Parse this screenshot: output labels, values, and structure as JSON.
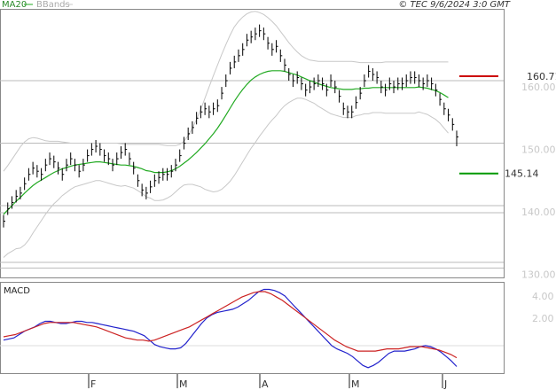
{
  "header": {
    "legend_ma": "MA20",
    "legend_bb": "BBands",
    "source": "© TEC 9/6/2024 3:0 GMT"
  },
  "colors": {
    "ma": "#22aa22",
    "bbands": "#c8c8c8",
    "candles": "#000000",
    "resistance": "#cc0000",
    "support": "#009900",
    "macd": "#2222cc",
    "signal": "#cc2222",
    "grid": "#bbbbbb"
  },
  "chart_data": [
    {
      "type": "candlestick",
      "title": "",
      "ylim": [
        120,
        170
      ],
      "y_ticks": [
        160,
        150,
        140,
        130
      ],
      "x_tick_labels": [
        "F",
        "M",
        "A",
        "M",
        "J"
      ],
      "grid": true,
      "legend": "top-left",
      "levels": [
        {
          "label": "160.71",
          "value": 160.71,
          "kind": "resistance"
        },
        {
          "label": "145.14",
          "value": 145.14,
          "kind": "support"
        }
      ],
      "series": [
        {
          "name": "price",
          "close": [
            137.5,
            139.5,
            140.5,
            141.5,
            142,
            143.5,
            145,
            146,
            145.5,
            145,
            146.5,
            147.5,
            147,
            146,
            145,
            146.5,
            147.5,
            146.5,
            145.5,
            146.5,
            148,
            149,
            149.5,
            149,
            148,
            147.5,
            146.5,
            147.5,
            148.5,
            149,
            147.5,
            146,
            144,
            142.5,
            142,
            143,
            144,
            144.5,
            145,
            145,
            145.5,
            146.5,
            148,
            150,
            151.5,
            152.5,
            154,
            155,
            155.5,
            155,
            155.5,
            156,
            158,
            160,
            162,
            163,
            164,
            165,
            166.5,
            167,
            167.5,
            168,
            167.5,
            166,
            165,
            165.5,
            164,
            162.5,
            161,
            160,
            160.5,
            159.5,
            158.5,
            159,
            159.5,
            160,
            159.5,
            158.5,
            160,
            159,
            157.5,
            155.5,
            155,
            155,
            156.5,
            158,
            160,
            161.5,
            161,
            160.5,
            159,
            158.5,
            159.5,
            159,
            159.5,
            159.5,
            160,
            160.5,
            160.5,
            160,
            159.5,
            160,
            159.5,
            158.5,
            157,
            155.5,
            154.5,
            153,
            151
          ],
          "high": [
            138.5,
            140.5,
            141.5,
            142.5,
            143,
            144.5,
            146,
            147,
            146.5,
            146,
            147.5,
            148.5,
            148,
            147,
            146,
            147.5,
            148.5,
            147.5,
            146.5,
            147.5,
            149,
            150,
            150.5,
            150,
            149,
            148.5,
            147.5,
            148.5,
            149.5,
            150,
            148.5,
            147,
            145,
            143.5,
            143,
            144,
            145,
            145.5,
            146,
            146,
            146.5,
            147.5,
            149,
            151,
            152.5,
            153.5,
            155,
            156,
            156.5,
            156,
            156.5,
            157,
            159,
            161,
            163,
            164,
            165,
            166,
            167.5,
            168,
            168.5,
            169,
            168.5,
            167,
            166,
            166.5,
            165,
            163.5,
            162,
            161,
            161.5,
            160.5,
            159.5,
            160,
            160.5,
            161,
            160.5,
            159.5,
            161,
            160,
            158.5,
            156.5,
            156,
            156,
            157.5,
            159,
            161,
            162.5,
            162,
            161.5,
            160,
            159.5,
            160.5,
            160,
            160.5,
            160.5,
            161,
            161.5,
            161.5,
            161,
            160.5,
            161,
            160.5,
            159.5,
            158,
            156.5,
            155.5,
            154,
            152
          ],
          "low": [
            136.5,
            138.5,
            139.5,
            140.5,
            141,
            142.5,
            144,
            145,
            144.5,
            144,
            145.5,
            146.5,
            146,
            145,
            144,
            145.5,
            146.5,
            145.5,
            144.5,
            145.5,
            147,
            148,
            148.5,
            148,
            147,
            146.5,
            145.5,
            146.5,
            147.5,
            148,
            146.5,
            145,
            143,
            141.5,
            141,
            142,
            143,
            143.5,
            144,
            144,
            144.5,
            145.5,
            147,
            149,
            150.5,
            151.5,
            153,
            154,
            154.5,
            154,
            154.5,
            155,
            157,
            159,
            161,
            162,
            163,
            164,
            165.5,
            166,
            166.5,
            167,
            166.5,
            165,
            164,
            164.5,
            163,
            161.5,
            160,
            159,
            159.5,
            158.5,
            157.5,
            158,
            158.5,
            159,
            158.5,
            157.5,
            159,
            158,
            156.5,
            154.5,
            154,
            154,
            155.5,
            157,
            159,
            160.5,
            160,
            159.5,
            158,
            157.5,
            158.5,
            158,
            158.5,
            158.5,
            159,
            159.5,
            159.5,
            159,
            158.5,
            159,
            158.5,
            157.5,
            156,
            154.5,
            153.5,
            152,
            149.5
          ]
        },
        {
          "name": "MA20",
          "values": [
            138.6,
            139.3,
            140,
            140.7,
            141.3,
            142,
            142.6,
            143.2,
            143.7,
            144.1,
            144.5,
            144.9,
            145.3,
            145.6,
            145.9,
            146.1,
            146.3,
            146.5,
            146.6,
            146.7,
            146.8,
            146.9,
            147,
            147,
            146.9,
            146.8,
            146.7,
            146.6,
            146.5,
            146.5,
            146.4,
            146.3,
            146.1,
            145.9,
            145.6,
            145.5,
            145.3,
            145.3,
            145.3,
            145.4,
            145.6,
            145.9,
            146.3,
            146.8,
            147.3,
            147.9,
            148.5,
            149.2,
            149.9,
            150.7,
            151.5,
            152.4,
            153.4,
            154.5,
            155.6,
            156.7,
            157.7,
            158.6,
            159.4,
            160.1,
            160.6,
            161,
            161.3,
            161.5,
            161.6,
            161.6,
            161.6,
            161.5,
            161.3,
            161.1,
            160.9,
            160.6,
            160.3,
            160,
            159.8,
            159.5,
            159.3,
            159.1,
            158.9,
            158.8,
            158.7,
            158.6,
            158.6,
            158.6,
            158.7,
            158.7,
            158.8,
            158.8,
            158.9,
            158.9,
            158.9,
            158.9,
            158.9,
            158.9,
            158.9,
            158.9,
            158.9,
            158.9,
            158.9,
            159,
            158.9,
            158.8,
            158.6,
            158.4,
            158.1,
            157.7,
            157.3
          ]
        },
        {
          "name": "BBands",
          "upper": [
            145.5,
            146.4,
            147.4,
            148.4,
            149.4,
            150.2,
            150.7,
            150.9,
            150.8,
            150.6,
            150.4,
            150.3,
            150.3,
            150.3,
            150.2,
            150.1,
            150,
            150,
            150,
            150,
            150,
            150,
            150,
            150,
            150,
            150,
            150,
            150,
            149.9,
            149.8,
            149.8,
            149.8,
            149.8,
            149.8,
            149.8,
            149.8,
            149.8,
            149.8,
            149.7,
            149.6,
            149.6,
            149.6,
            149.8,
            150.3,
            151.2,
            152.4,
            153.8,
            155.4,
            157.2,
            159,
            160.8,
            162.5,
            164.2,
            165.8,
            167.3,
            168.6,
            169.5,
            170.2,
            170.7,
            171,
            171.1,
            170.9,
            170.6,
            170.1,
            169.5,
            168.8,
            167.9,
            167,
            166.1,
            165.3,
            164.6,
            164,
            163.6,
            163.3,
            163.2,
            163.1,
            163.1,
            163.1,
            163.1,
            163.1,
            163.1,
            163.1,
            163.1,
            163.1,
            163,
            162.9,
            162.9,
            162.9,
            162.9,
            162.9,
            162.9,
            163,
            163,
            163,
            163,
            163,
            163,
            163,
            163,
            163,
            163,
            163,
            163,
            163,
            163,
            163,
            163
          ],
          "lower": [
            131.7,
            132.3,
            132.7,
            133.1,
            133.2,
            133.7,
            134.5,
            135.6,
            136.6,
            137.6,
            138.6,
            139.5,
            140.3,
            140.9,
            141.6,
            142.1,
            142.6,
            143,
            143.2,
            143.4,
            143.6,
            143.8,
            144,
            144,
            143.8,
            143.6,
            143.4,
            143.2,
            143.1,
            143.2,
            143,
            142.8,
            142.4,
            142,
            141.4,
            141.2,
            140.8,
            140.8,
            140.9,
            141.2,
            141.6,
            142.2,
            142.8,
            143.3,
            143.4,
            143.4,
            143.2,
            143,
            142.6,
            142.4,
            142.2,
            142.3,
            142.6,
            143.2,
            143.9,
            144.8,
            145.9,
            147,
            148.1,
            149.2,
            150.1,
            151.1,
            152,
            152.9,
            153.7,
            154.4,
            155.3,
            156,
            156.5,
            156.9,
            157.2,
            157.2,
            157,
            156.7,
            156.4,
            155.9,
            155.5,
            155.1,
            154.7,
            154.5,
            154.3,
            154.1,
            154.1,
            154.1,
            154.4,
            154.5,
            154.7,
            154.7,
            154.9,
            154.9,
            154.9,
            154.8,
            154.8,
            154.8,
            154.8,
            154.8,
            154.8,
            154.8,
            154.8,
            155,
            154.8,
            154.6,
            154.2,
            153.8,
            153.2,
            152.4,
            151.6
          ]
        }
      ]
    },
    {
      "type": "line",
      "title": "MACD",
      "y_ticks": [
        4,
        2
      ],
      "y_tick_labels": [
        "4.00",
        "2.00"
      ],
      "series": [
        {
          "name": "MACD",
          "values": [
            0,
            0.1,
            0.2,
            0.5,
            0.8,
            1,
            1.2,
            1.5,
            1.7,
            1.7,
            1.6,
            1.5,
            1.5,
            1.6,
            1.7,
            1.7,
            1.6,
            1.6,
            1.5,
            1.4,
            1.3,
            1.2,
            1.1,
            1,
            0.9,
            0.8,
            0.6,
            0.4,
            0,
            -0.4,
            -0.6,
            -0.7,
            -0.8,
            -0.8,
            -0.7,
            -0.3,
            0.3,
            0.9,
            1.5,
            2,
            2.3,
            2.5,
            2.6,
            2.7,
            2.8,
            3,
            3.3,
            3.6,
            4,
            4.4,
            4.6,
            4.6,
            4.5,
            4.3,
            4,
            3.5,
            3,
            2.5,
            2,
            1.5,
            1,
            0.5,
            0,
            -0.5,
            -0.8,
            -1,
            -1.2,
            -1.5,
            -1.9,
            -2.3,
            -2.5,
            -2.3,
            -2,
            -1.6,
            -1.2,
            -1,
            -1,
            -1,
            -0.9,
            -0.8,
            -0.6,
            -0.5,
            -0.6,
            -0.8,
            -1.1,
            -1.5,
            -1.9,
            -2.4
          ],
          "offset": 0
        },
        {
          "name": "Signal",
          "values": [
            0.3,
            0.4,
            0.5,
            0.7,
            0.9,
            1.1,
            1.3,
            1.5,
            1.6,
            1.6,
            1.6,
            1.6,
            1.6,
            1.5,
            1.4,
            1.3,
            1.2,
            1,
            0.8,
            0.6,
            0.4,
            0.2,
            0.1,
            0,
            0,
            -0.1,
            0,
            0.2,
            0.4,
            0.6,
            0.8,
            1,
            1.2,
            1.5,
            1.8,
            2.1,
            2.4,
            2.7,
            3,
            3.3,
            3.6,
            3.9,
            4.1,
            4.3,
            4.4,
            4.4,
            4.2,
            3.9,
            3.6,
            3.2,
            2.8,
            2.4,
            2,
            1.6,
            1.2,
            0.8,
            0.4,
            0,
            -0.3,
            -0.6,
            -0.8,
            -1,
            -1,
            -1,
            -1,
            -0.9,
            -0.8,
            -0.8,
            -0.8,
            -0.7,
            -0.6,
            -0.6,
            -0.6,
            -0.7,
            -0.8,
            -0.9,
            -1.1,
            -1.3,
            -1.6
          ],
          "offset": 0
        }
      ]
    }
  ]
}
